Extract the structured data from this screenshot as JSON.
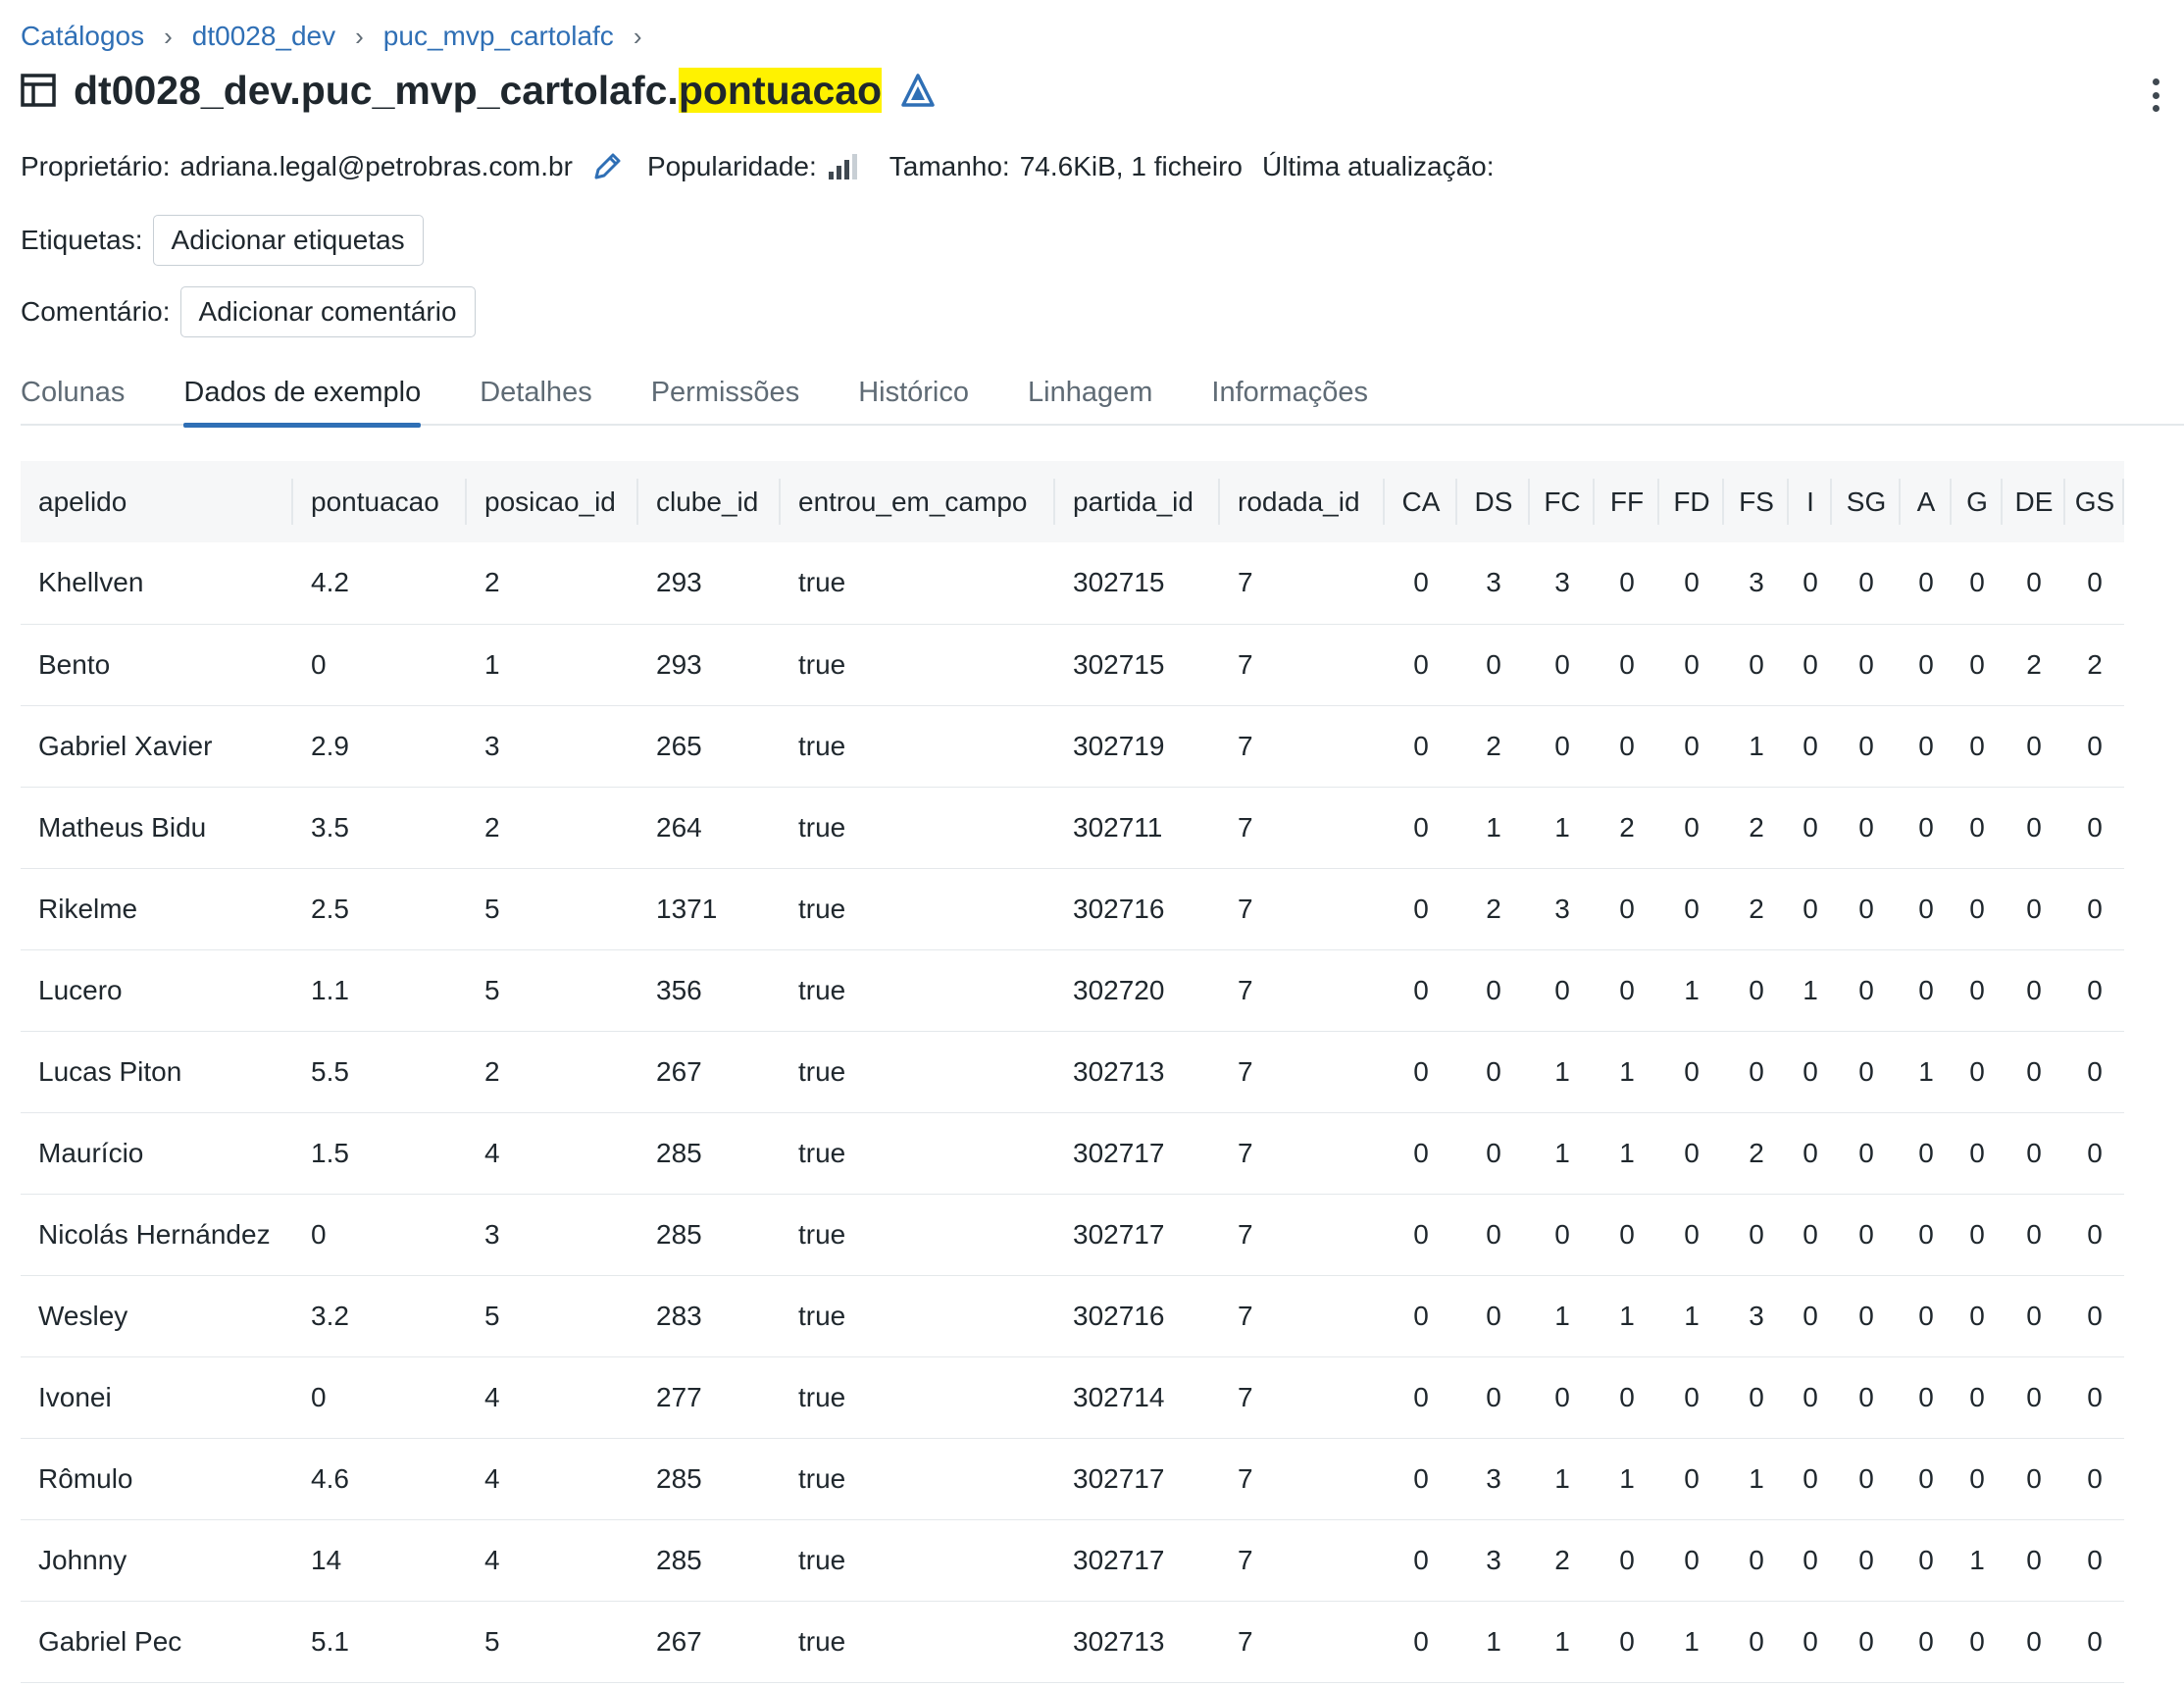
{
  "breadcrumb": [
    "Catálogos",
    "dt0028_dev",
    "puc_mvp_cartolafc"
  ],
  "title": {
    "prefix": "dt0028_dev.puc_mvp_cartolafc.",
    "highlight": "pontuacao"
  },
  "meta": {
    "owner_label": "Proprietário:",
    "owner_value": "adriana.legal@petrobras.com.br",
    "popularity_label": "Popularidade:",
    "size_label": "Tamanho:",
    "size_value": "74.6KiB, 1 ficheiro",
    "updated_label": "Última atualização:"
  },
  "tags": {
    "label": "Etiquetas:",
    "button": "Adicionar etiquetas"
  },
  "comment": {
    "label": "Comentário:",
    "button": "Adicionar comentário"
  },
  "tabs": [
    "Colunas",
    "Dados de exemplo",
    "Detalhes",
    "Permissões",
    "Histórico",
    "Linhagem",
    "Informações"
  ],
  "active_tab": "Dados de exemplo",
  "colors": {
    "accent": "#2f6fb5",
    "highlight": "#fff200",
    "header_bg": "#f6f7f8"
  },
  "table": {
    "columns": [
      "apelido",
      "pontuacao",
      "posicao_id",
      "clube_id",
      "entrou_em_campo",
      "partida_id",
      "rodada_id",
      "CA",
      "DS",
      "FC",
      "FF",
      "FD",
      "FS",
      "I",
      "SG",
      "A",
      "G",
      "DE",
      "GS"
    ],
    "rows": [
      [
        "Khellven",
        "4.2",
        "2",
        "293",
        "true",
        "302715",
        "7",
        "0",
        "3",
        "3",
        "0",
        "0",
        "3",
        "0",
        "0",
        "0",
        "0",
        "0",
        "0"
      ],
      [
        "Bento",
        "0",
        "1",
        "293",
        "true",
        "302715",
        "7",
        "0",
        "0",
        "0",
        "0",
        "0",
        "0",
        "0",
        "0",
        "0",
        "0",
        "2",
        "2"
      ],
      [
        "Gabriel Xavier",
        "2.9",
        "3",
        "265",
        "true",
        "302719",
        "7",
        "0",
        "2",
        "0",
        "0",
        "0",
        "1",
        "0",
        "0",
        "0",
        "0",
        "0",
        "0"
      ],
      [
        "Matheus Bidu",
        "3.5",
        "2",
        "264",
        "true",
        "302711",
        "7",
        "0",
        "1",
        "1",
        "2",
        "0",
        "2",
        "0",
        "0",
        "0",
        "0",
        "0",
        "0"
      ],
      [
        "Rikelme",
        "2.5",
        "5",
        "1371",
        "true",
        "302716",
        "7",
        "0",
        "2",
        "3",
        "0",
        "0",
        "2",
        "0",
        "0",
        "0",
        "0",
        "0",
        "0"
      ],
      [
        "Lucero",
        "1.1",
        "5",
        "356",
        "true",
        "302720",
        "7",
        "0",
        "0",
        "0",
        "0",
        "1",
        "0",
        "1",
        "0",
        "0",
        "0",
        "0",
        "0"
      ],
      [
        "Lucas Piton",
        "5.5",
        "2",
        "267",
        "true",
        "302713",
        "7",
        "0",
        "0",
        "1",
        "1",
        "0",
        "0",
        "0",
        "0",
        "1",
        "0",
        "0",
        "0"
      ],
      [
        "Maurício",
        "1.5",
        "4",
        "285",
        "true",
        "302717",
        "7",
        "0",
        "0",
        "1",
        "1",
        "0",
        "2",
        "0",
        "0",
        "0",
        "0",
        "0",
        "0"
      ],
      [
        "Nicolás Hernández",
        "0",
        "3",
        "285",
        "true",
        "302717",
        "7",
        "0",
        "0",
        "0",
        "0",
        "0",
        "0",
        "0",
        "0",
        "0",
        "0",
        "0",
        "0"
      ],
      [
        "Wesley",
        "3.2",
        "5",
        "283",
        "true",
        "302716",
        "7",
        "0",
        "0",
        "1",
        "1",
        "1",
        "3",
        "0",
        "0",
        "0",
        "0",
        "0",
        "0"
      ],
      [
        "Ivonei",
        "0",
        "4",
        "277",
        "true",
        "302714",
        "7",
        "0",
        "0",
        "0",
        "0",
        "0",
        "0",
        "0",
        "0",
        "0",
        "0",
        "0",
        "0"
      ],
      [
        "Rômulo",
        "4.6",
        "4",
        "285",
        "true",
        "302717",
        "7",
        "0",
        "3",
        "1",
        "1",
        "0",
        "1",
        "0",
        "0",
        "0",
        "0",
        "0",
        "0"
      ],
      [
        "Johnny",
        "14",
        "4",
        "285",
        "true",
        "302717",
        "7",
        "0",
        "3",
        "2",
        "0",
        "0",
        "0",
        "0",
        "0",
        "0",
        "1",
        "0",
        "0"
      ],
      [
        "Gabriel Pec",
        "5.1",
        "5",
        "267",
        "true",
        "302713",
        "7",
        "0",
        "1",
        "1",
        "0",
        "1",
        "0",
        "0",
        "0",
        "0",
        "0",
        "0",
        "0"
      ]
    ]
  }
}
